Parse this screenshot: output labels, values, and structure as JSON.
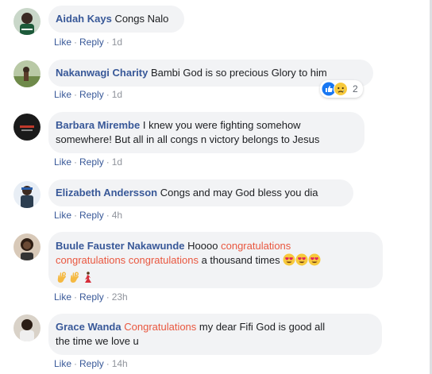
{
  "comments": [
    {
      "author": "Aidah Kays",
      "text": "Congs Nalo",
      "like": "Like",
      "reply": "Reply",
      "time": "1d"
    },
    {
      "author": "Nakanwagi Charity",
      "text": "Bambi God is so precious Glory to him",
      "like": "Like",
      "reply": "Reply",
      "time": "1d",
      "reactions": {
        "icons": [
          "like-icon",
          "sad-icon"
        ],
        "count": "2"
      }
    },
    {
      "author": "Barbara Mirembe",
      "text_line1": "I knew you were fighting somehow",
      "text_line2": "somewhere! But all in all congs n victory belongs to Jesus",
      "like": "Like",
      "reply": "Reply",
      "time": "1d"
    },
    {
      "author": "Elizabeth Andersson",
      "text": "Congs and may God bless you dia",
      "like": "Like",
      "reply": "Reply",
      "time": "4h"
    },
    {
      "author": "Buule Fauster Nakawunde",
      "text_pre": "Hoooo",
      "highlight1": "congratulations",
      "highlight2": "congratulations congratulations",
      "text_post": "a thousand times",
      "emojis_line1": [
        "heart-eyes-icon",
        "heart-eyes-icon",
        "heart-eyes-icon"
      ],
      "emojis_line2": [
        "ok-hand-icon",
        "ok-hand-icon",
        "dancer-icon"
      ],
      "like": "Like",
      "reply": "Reply",
      "time": "23h"
    },
    {
      "author": "Grace Wanda",
      "highlight": "Congratulations",
      "text_line1": "my dear Fifi God is good all",
      "text_line2": "the time we love u",
      "like": "Like",
      "reply": "Reply",
      "time": "14h"
    }
  ],
  "colors": {
    "author": "#385898",
    "highlight": "#e9573f",
    "bubble": "#f2f3f5",
    "meta": "#90949c"
  }
}
